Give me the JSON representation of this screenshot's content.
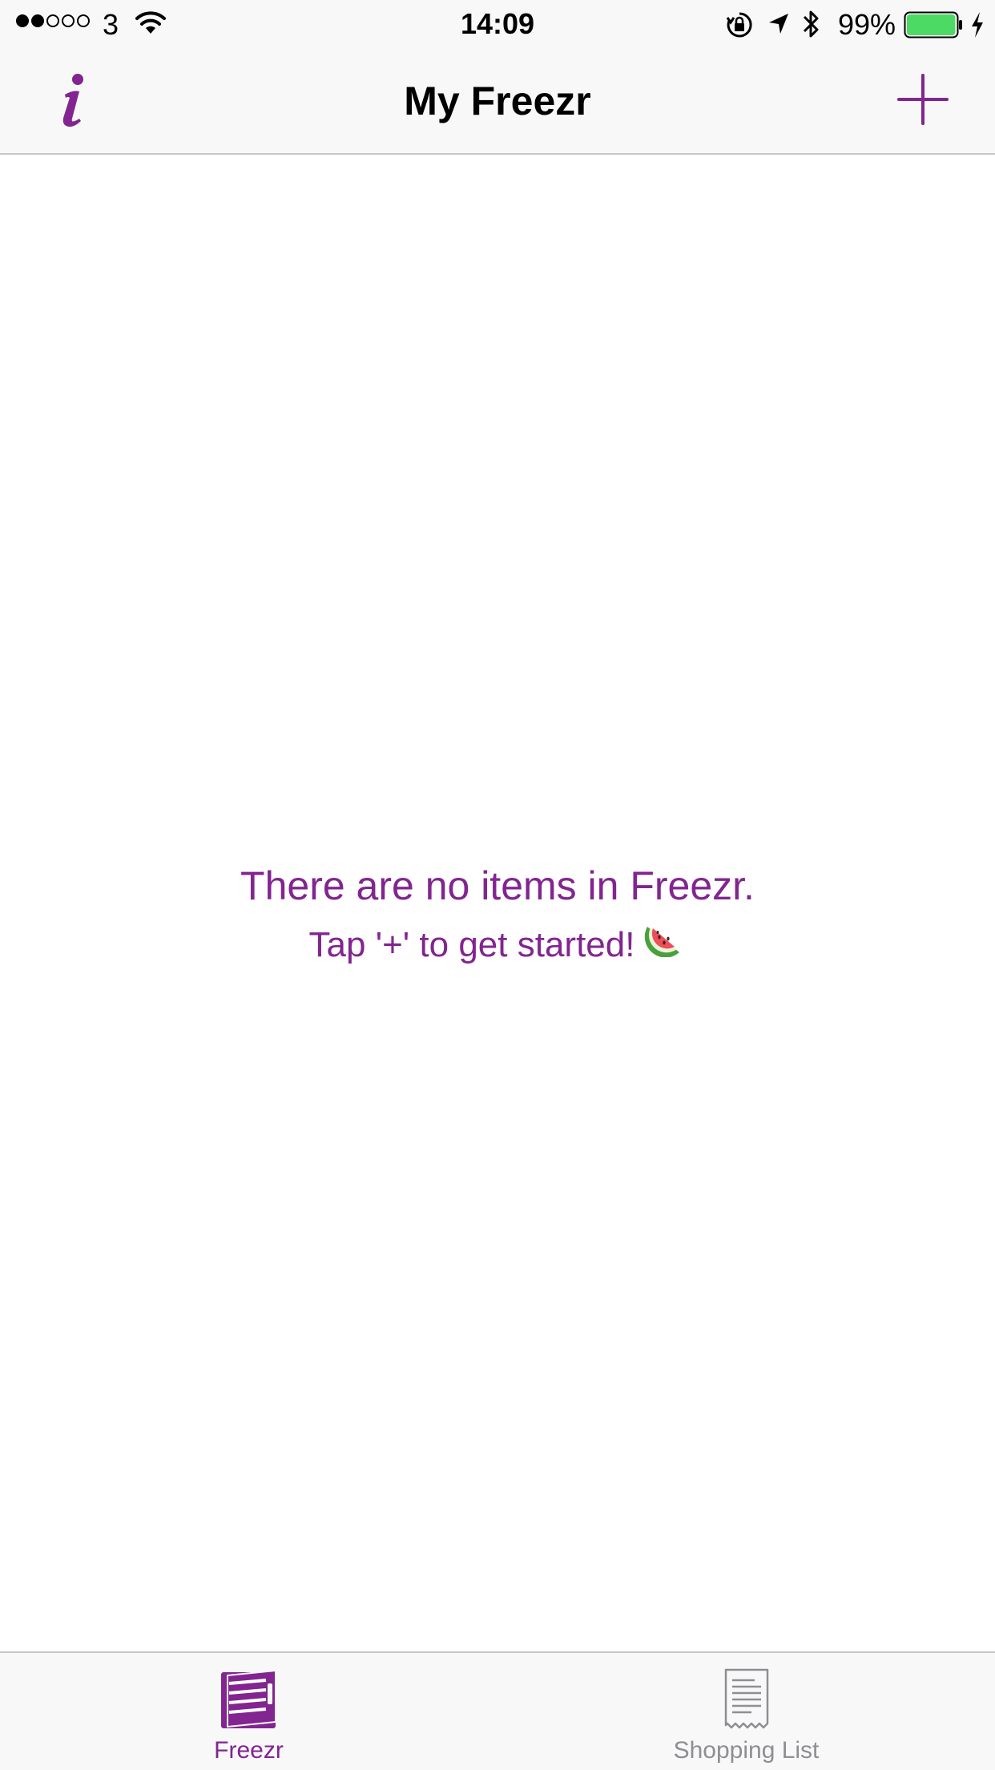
{
  "status_bar": {
    "signal_filled": 2,
    "signal_total": 5,
    "carrier": "3",
    "time": "14:09",
    "battery_percent": "99%",
    "battery_level": 0.99,
    "icons": [
      "wifi-icon",
      "rotation-lock-icon",
      "location-arrow-icon",
      "bluetooth-icon",
      "battery-icon",
      "charging-bolt-icon"
    ]
  },
  "nav": {
    "title": "My Freezr",
    "left_icon": "info-icon",
    "right_icon": "plus-icon"
  },
  "empty_state": {
    "line1": "There are no items in Freezr.",
    "line2": "Tap '+' to get started!",
    "emoji_icon": "watermelon-icon"
  },
  "tabs": [
    {
      "label": "Freezr",
      "icon": "freezer-icon",
      "active": true
    },
    {
      "label": "Shopping List",
      "icon": "receipt-icon",
      "active": false
    }
  ],
  "colors": {
    "accent": "#822590",
    "inactive": "#8e8e93",
    "battery": "#4cd964",
    "bar_background": "#f8f8f8"
  }
}
